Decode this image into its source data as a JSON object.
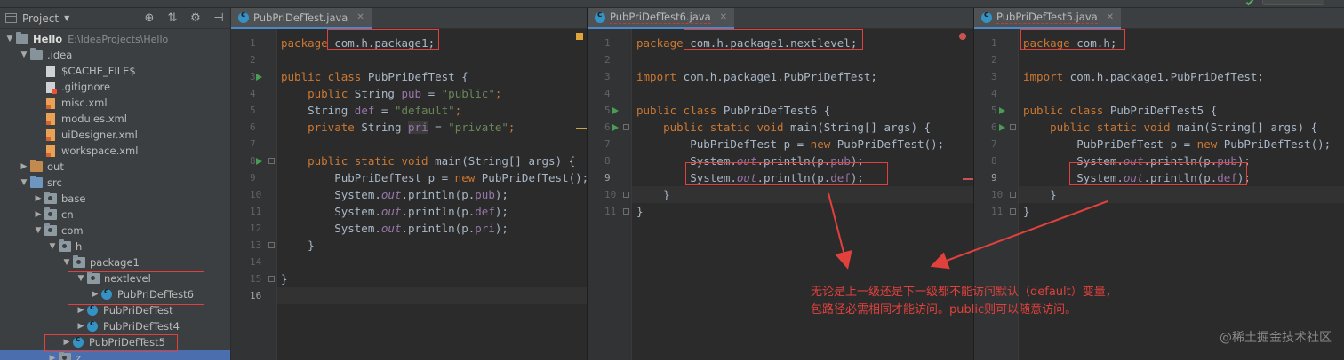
{
  "project": {
    "title": "Project",
    "tree": [
      {
        "label": "Hello",
        "path": "E:\\IdeaProjects\\Hello",
        "depth": 0,
        "arrow": "down",
        "icon": "folder"
      },
      {
        "label": ".idea",
        "depth": 1,
        "arrow": "down",
        "icon": "folder"
      },
      {
        "label": "$CACHE_FILE$",
        "depth": 2,
        "arrow": "",
        "icon": "file"
      },
      {
        "label": ".gitignore",
        "depth": 2,
        "arrow": "",
        "icon": "git"
      },
      {
        "label": "misc.xml",
        "depth": 2,
        "arrow": "",
        "icon": "xml"
      },
      {
        "label": "modules.xml",
        "depth": 2,
        "arrow": "",
        "icon": "xml"
      },
      {
        "label": "uiDesigner.xml",
        "depth": 2,
        "arrow": "",
        "icon": "xml"
      },
      {
        "label": "workspace.xml",
        "depth": 2,
        "arrow": "",
        "icon": "xml"
      },
      {
        "label": "out",
        "depth": 1,
        "arrow": "right",
        "icon": "folder-orange"
      },
      {
        "label": "src",
        "depth": 1,
        "arrow": "down",
        "icon": "folder-blue"
      },
      {
        "label": "base",
        "depth": 2,
        "arrow": "right",
        "icon": "package"
      },
      {
        "label": "cn",
        "depth": 2,
        "arrow": "right",
        "icon": "package"
      },
      {
        "label": "com",
        "depth": 2,
        "arrow": "down",
        "icon": "package"
      },
      {
        "label": "h",
        "depth": 3,
        "arrow": "down",
        "icon": "package"
      },
      {
        "label": "package1",
        "depth": 4,
        "arrow": "down",
        "icon": "package"
      },
      {
        "label": "nextlevel",
        "depth": 5,
        "arrow": "down",
        "icon": "package"
      },
      {
        "label": "PubPriDefTest6",
        "depth": 6,
        "arrow": "right",
        "icon": "class"
      },
      {
        "label": "PubPriDefTest",
        "depth": 5,
        "arrow": "right",
        "icon": "class"
      },
      {
        "label": "PubPriDefTest4",
        "depth": 5,
        "arrow": "right",
        "icon": "class"
      },
      {
        "label": "PubPriDefTest5",
        "depth": 4,
        "arrow": "right",
        "icon": "class"
      },
      {
        "label": "z",
        "depth": 3,
        "arrow": "right",
        "icon": "package"
      }
    ]
  },
  "editors": [
    {
      "tab": "PubPriDefTest.java",
      "line_numbers": [
        "1",
        "2",
        "3",
        "4",
        "5",
        "6",
        "7",
        "8",
        "9",
        "10",
        "11",
        "12",
        "13",
        "14",
        "15",
        "16"
      ],
      "current_line": "16"
    },
    {
      "tab": "PubPriDefTest6.java",
      "line_numbers": [
        "1",
        "2",
        "3",
        "4",
        "5",
        "6",
        "7",
        "8",
        "9",
        "10",
        "11"
      ],
      "current_line": "9"
    },
    {
      "tab": "PubPriDefTest5.java",
      "line_numbers": [
        "1",
        "2",
        "3",
        "4",
        "5",
        "6",
        "7",
        "8",
        "9",
        "10",
        "11"
      ],
      "current_line": "9"
    }
  ],
  "code1": {
    "l1_kw": "package",
    "l1_pkg": " com.h.package1;",
    "l3_kw": "public class",
    "l3_name": " PubPriDefTest {",
    "l4_kw": "    public",
    "l4_type": " String ",
    "l4_field": "pub",
    "l4_eq": " = ",
    "l4_str": "\"public\"",
    "l4_end": ";",
    "l5_type": "    String ",
    "l5_field": "def",
    "l5_eq": " = ",
    "l5_str": "\"default\"",
    "l5_end": ";",
    "l6_kw": "    private",
    "l6_type": " String ",
    "l6_field": "pri",
    "l6_eq": " = ",
    "l6_str": "\"private\"",
    "l6_end": ";",
    "l8_kw": "    public static void",
    "l8_rest": " main(String[] args) {",
    "l9_a": "        PubPriDefTest p = ",
    "l9_kw": "new",
    "l9_b": " PubPriDefTest();",
    "l10_a": "        System.",
    "l10_out": "out",
    "l10_b": ".println(p.",
    "l10_f": "pub",
    "l10_c": ");",
    "l11_a": "        System.",
    "l11_out": "out",
    "l11_b": ".println(p.",
    "l11_f": "def",
    "l11_c": ");",
    "l12_a": "        System.",
    "l12_out": "out",
    "l12_b": ".println(p.",
    "l12_f": "pri",
    "l12_c": ");",
    "l13": "    }",
    "l15": "}"
  },
  "code2": {
    "l1_kw": "package",
    "l1_pkg": " com.h.package1.nextlevel;",
    "l3_kw": "import",
    "l3_rest": " com.h.package1.PubPriDefTest;",
    "l5_kw": "public class",
    "l5_name": " PubPriDefTest6 {",
    "l6_kw": "    public static void",
    "l6_rest": " main(String[] args) {",
    "l7_a": "        PubPriDefTest p = ",
    "l7_kw": "new",
    "l7_b": " PubPriDefTest();",
    "l8_a": "        System.",
    "l8_out": "out",
    "l8_b": ".println(p.",
    "l8_f": "pub",
    "l8_c": ");",
    "l9_a": "        System.",
    "l9_out": "out",
    "l9_b": ".println(p.",
    "l9_f": "def",
    "l9_c": ");",
    "l10": "    }",
    "l11": "}"
  },
  "code3": {
    "l1_kw": "package",
    "l1_pkg": " com.h;",
    "l3_kw": "import",
    "l3_rest": " com.h.package1.PubPriDefTest;",
    "l5_kw": "public class",
    "l5_name": " PubPriDefTest5 {",
    "l6_kw": "    public static void",
    "l6_rest": " main(String[] args) {",
    "l7_a": "        PubPriDefTest p = ",
    "l7_kw": "new",
    "l7_b": " PubPriDefTest();",
    "l8_a": "        System.",
    "l8_out": "out",
    "l8_b": ".println(p.",
    "l8_f": "pub",
    "l8_c": ");",
    "l9_a": "        System.",
    "l9_out": "out",
    "l9_b": ".println(p.",
    "l9_f": "def",
    "l9_c": ");",
    "l10": "    }",
    "l11": "}"
  },
  "annotation": {
    "line1": "无论是上一级还是下一级都不能访问默认（default）变量，",
    "line2": "包路径必需相同才能访问。public则可以随意访问。"
  },
  "watermark": "@稀土掘金技术社区",
  "colors": {
    "keyword": "#cc7832",
    "string": "#6a8759",
    "field": "#9876aa",
    "annotation": "#e0413d",
    "tab_accent": "#4a88c7",
    "panel": "#3c3f41",
    "editor": "#2b2b2b"
  }
}
